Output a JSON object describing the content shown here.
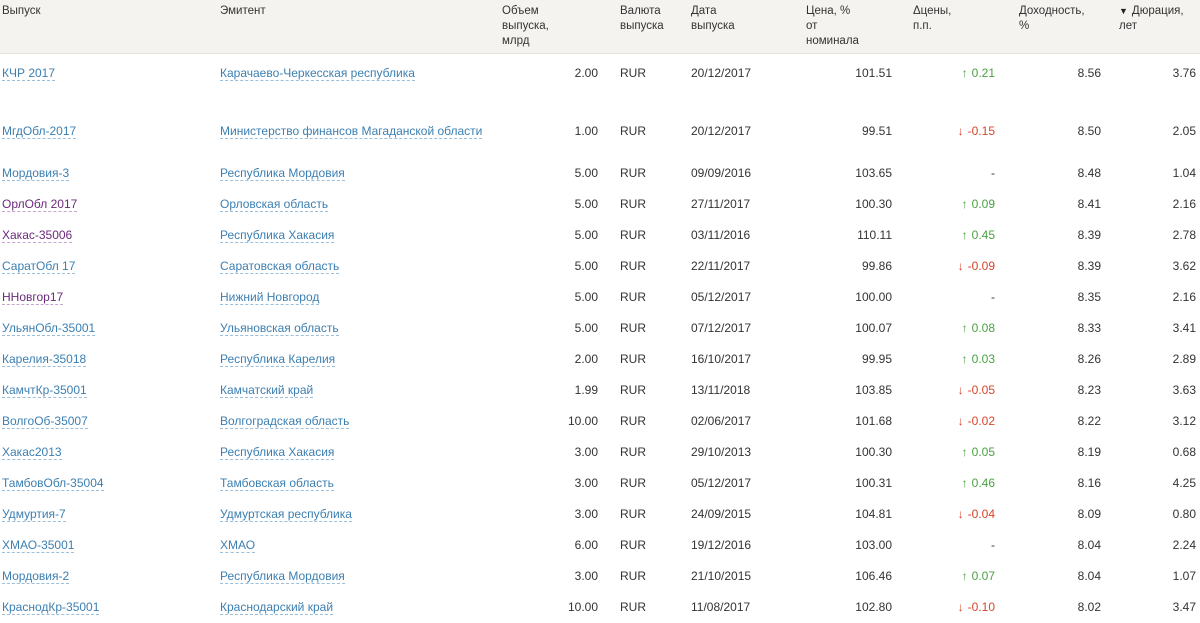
{
  "columns": [
    {
      "label": "Выпуск",
      "align": "left"
    },
    {
      "label": "Эмитент",
      "align": "left"
    },
    {
      "label": "Объем\nвыпуска,\nмлрд",
      "align": "left"
    },
    {
      "label": "Валюта\nвыпуска",
      "align": "left"
    },
    {
      "label": "Дата\nвыпуска",
      "align": "left"
    },
    {
      "label": "Цена, %\nот\nноминала",
      "align": "left"
    },
    {
      "label": "Δцены,\nп.п.",
      "align": "left"
    },
    {
      "label": "Доходность,\n%",
      "align": "left"
    },
    {
      "label": "Дюрация,\nлет",
      "align": "left",
      "sorted": "desc"
    }
  ],
  "rows": [
    {
      "issue": "КЧР 2017",
      "issuer": "Карачаево-Черкесская республика",
      "volume": "2.00",
      "currency": "RUR",
      "date": "20/12/2017",
      "price": "101.51",
      "delta": "0.21",
      "delta_dir": "up",
      "yield": "8.56",
      "duration": "3.76"
    },
    {
      "issue": "МгдОбл-2017",
      "issuer": "Министерство финансов Магаданской области",
      "volume": "1.00",
      "currency": "RUR",
      "date": "20/12/2017",
      "price": "99.51",
      "delta": "-0.15",
      "delta_dir": "down",
      "yield": "8.50",
      "duration": "2.05"
    },
    {
      "issue": "Мордовия-3",
      "issuer": "Республика Мордовия",
      "volume": "5.00",
      "currency": "RUR",
      "date": "09/09/2016",
      "price": "103.65",
      "delta": "-",
      "delta_dir": "none",
      "yield": "8.48",
      "duration": "1.04"
    },
    {
      "issue": "ОрлОбл 2017",
      "issuer": "Орловская область",
      "volume": "5.00",
      "currency": "RUR",
      "date": "27/11/2017",
      "price": "100.30",
      "delta": "0.09",
      "delta_dir": "up",
      "yield": "8.41",
      "duration": "2.16",
      "visited": true
    },
    {
      "issue": "Хакас-35006",
      "issuer": "Республика Хакасия",
      "volume": "5.00",
      "currency": "RUR",
      "date": "03/11/2016",
      "price": "110.11",
      "delta": "0.45",
      "delta_dir": "up",
      "yield": "8.39",
      "duration": "2.78",
      "visited": true
    },
    {
      "issue": "СаратОбл 17",
      "issuer": "Саратовская область",
      "volume": "5.00",
      "currency": "RUR",
      "date": "22/11/2017",
      "price": "99.86",
      "delta": "-0.09",
      "delta_dir": "down",
      "yield": "8.39",
      "duration": "3.62"
    },
    {
      "issue": "ННовгор17",
      "issuer": "Нижний Новгород",
      "volume": "5.00",
      "currency": "RUR",
      "date": "05/12/2017",
      "price": "100.00",
      "delta": "-",
      "delta_dir": "none",
      "yield": "8.35",
      "duration": "2.16",
      "visited": true
    },
    {
      "issue": "УльянОбл-35001",
      "issuer": "Ульяновская область",
      "volume": "5.00",
      "currency": "RUR",
      "date": "07/12/2017",
      "price": "100.07",
      "delta": "0.08",
      "delta_dir": "up",
      "yield": "8.33",
      "duration": "3.41"
    },
    {
      "issue": "Карелия-35018",
      "issuer": "Республика Карелия",
      "volume": "2.00",
      "currency": "RUR",
      "date": "16/10/2017",
      "price": "99.95",
      "delta": "0.03",
      "delta_dir": "up",
      "yield": "8.26",
      "duration": "2.89"
    },
    {
      "issue": "КамчтКр-35001",
      "issuer": "Камчатский край",
      "volume": "1.99",
      "currency": "RUR",
      "date": "13/11/2018",
      "price": "103.85",
      "delta": "-0.05",
      "delta_dir": "down",
      "yield": "8.23",
      "duration": "3.63"
    },
    {
      "issue": "ВолгоОб-35007",
      "issuer": "Волгоградская область",
      "volume": "10.00",
      "currency": "RUR",
      "date": "02/06/2017",
      "price": "101.68",
      "delta": "-0.02",
      "delta_dir": "down",
      "yield": "8.22",
      "duration": "3.12"
    },
    {
      "issue": "Хакас2013",
      "issuer": "Республика Хакасия",
      "volume": "3.00",
      "currency": "RUR",
      "date": "29/10/2013",
      "price": "100.30",
      "delta": "0.05",
      "delta_dir": "up",
      "yield": "8.19",
      "duration": "0.68"
    },
    {
      "issue": "ТамбовОбл-35004",
      "issuer": "Тамбовская область",
      "volume": "3.00",
      "currency": "RUR",
      "date": "05/12/2017",
      "price": "100.31",
      "delta": "0.46",
      "delta_dir": "up",
      "yield": "8.16",
      "duration": "4.25"
    },
    {
      "issue": "Удмуртия-7",
      "issuer": "Удмуртская республика",
      "volume": "3.00",
      "currency": "RUR",
      "date": "24/09/2015",
      "price": "104.81",
      "delta": "-0.04",
      "delta_dir": "down",
      "yield": "8.09",
      "duration": "0.80"
    },
    {
      "issue": "ХМАО-35001",
      "issuer": "ХМАО",
      "volume": "6.00",
      "currency": "RUR",
      "date": "19/12/2016",
      "price": "103.00",
      "delta": "-",
      "delta_dir": "none",
      "yield": "8.04",
      "duration": "2.24"
    },
    {
      "issue": "Мордовия-2",
      "issuer": "Республика Мордовия",
      "volume": "3.00",
      "currency": "RUR",
      "date": "21/10/2015",
      "price": "106.46",
      "delta": "0.07",
      "delta_dir": "up",
      "yield": "8.04",
      "duration": "1.07"
    },
    {
      "issue": "КраснодКр-35001",
      "issuer": "Краснодарский край",
      "volume": "10.00",
      "currency": "RUR",
      "date": "11/08/2017",
      "price": "102.80",
      "delta": "-0.10",
      "delta_dir": "down",
      "yield": "8.02",
      "duration": "3.47"
    }
  ],
  "icons": {
    "sort": "sort-desc-icon",
    "up": "arrow-up-icon",
    "down": "arrow-down-icon"
  },
  "colors": {
    "link": "#3c7fb1",
    "visited": "#6b2a7a",
    "up": "#4aa142",
    "down": "#d9442c",
    "header_bg": "#f5f3ef"
  }
}
